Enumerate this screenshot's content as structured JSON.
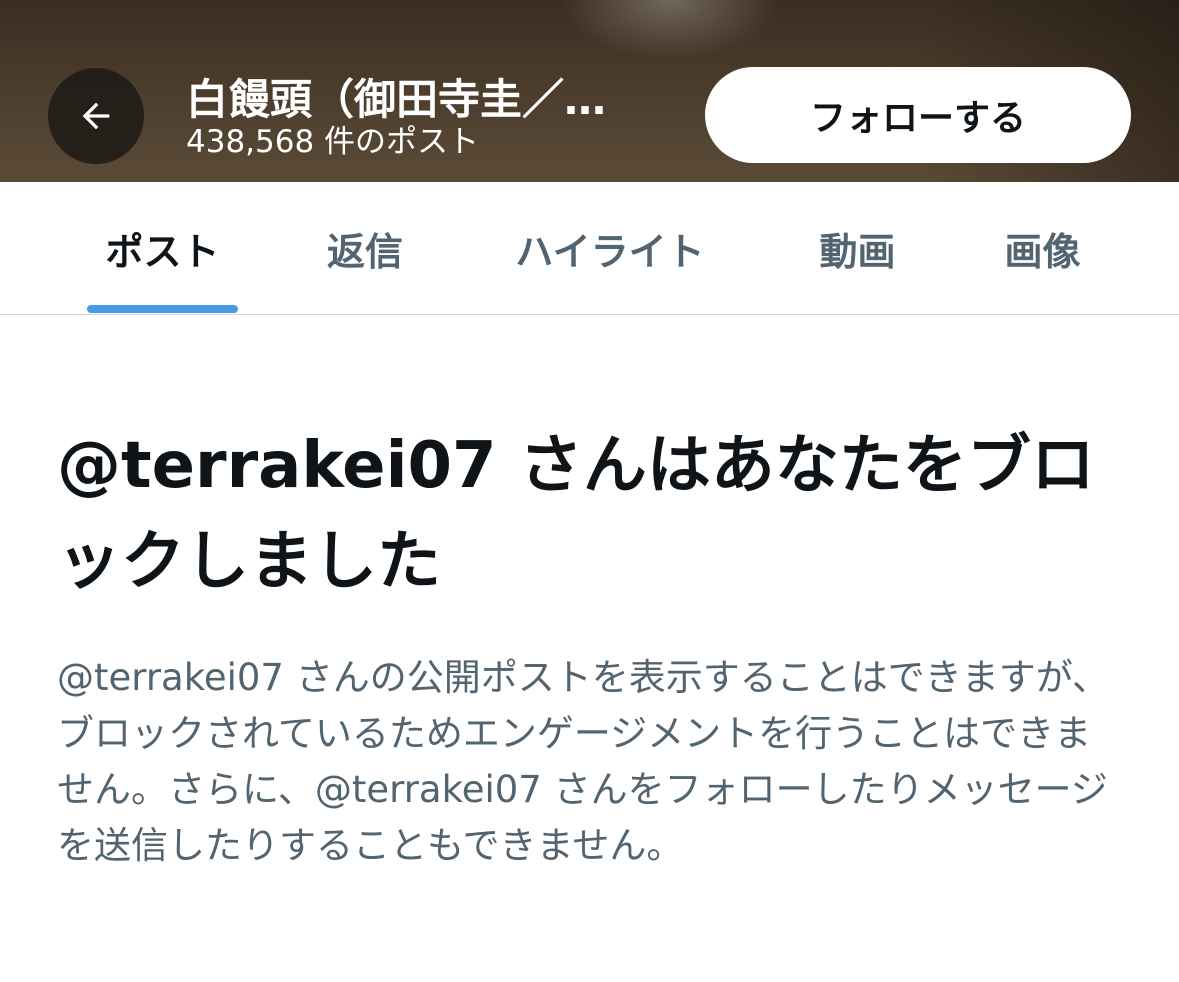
{
  "header": {
    "profile_name": "白饅頭（御田寺圭／…",
    "post_count": "438,568 件のポスト",
    "follow_label": "フォローする",
    "back_icon": "arrow-left-icon"
  },
  "tabs": [
    {
      "label": "ポスト",
      "active": true
    },
    {
      "label": "返信",
      "active": false
    },
    {
      "label": "ハイライト",
      "active": false
    },
    {
      "label": "動画",
      "active": false
    },
    {
      "label": "画像",
      "active": false
    }
  ],
  "blocked": {
    "title": "@terrakei07 さんはあなたをブロックしました",
    "description": "@terrakei07 さんの公開ポストを表示することはできますが、ブロックされているためエンゲージメントを行うことはできません。さらに、@terrakei07 さんをフォローしたりメッセージを送信したりすることもできません。"
  },
  "colors": {
    "accent": "#4a99e9",
    "text_primary": "#0f1419",
    "text_secondary": "#536471"
  }
}
